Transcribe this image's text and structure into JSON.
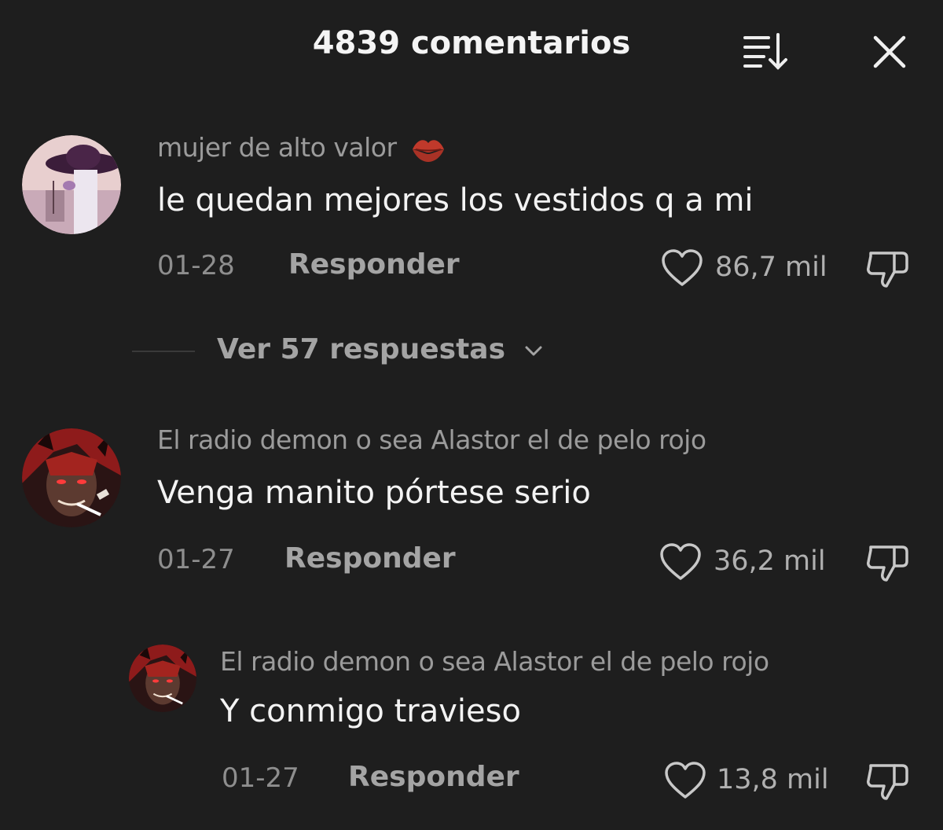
{
  "header": {
    "title": "4839 comentarios"
  },
  "comments": [
    {
      "username": "mujer de alto valor",
      "text": "le quedan mejores los vestidos q a mi",
      "date": "01-28",
      "reply_label": "Responder",
      "likes": "86,7 mil"
    },
    {
      "username": "El radio demon o sea Alastor el de pelo rojo",
      "text": "Venga manito pórtese serio",
      "date": "01-27",
      "reply_label": "Responder",
      "likes": "36,2 mil"
    }
  ],
  "view_replies": {
    "label": "Ver 57 respuestas"
  },
  "nested_reply": {
    "username": "El radio demon o sea Alastor el de pelo rojo",
    "text": "Y conmigo travieso",
    "date": "01-27",
    "reply_label": "Responder",
    "likes": "13,8 mil"
  },
  "colors": {
    "background": "#1e1e1e",
    "kiss_icon": "#c0392b",
    "muted_text": "#9b9b9b"
  },
  "icons": [
    "sort-icon",
    "close-icon",
    "kiss-emoji-icon",
    "heart-icon",
    "dislike-icon",
    "chevron-down-icon"
  ]
}
